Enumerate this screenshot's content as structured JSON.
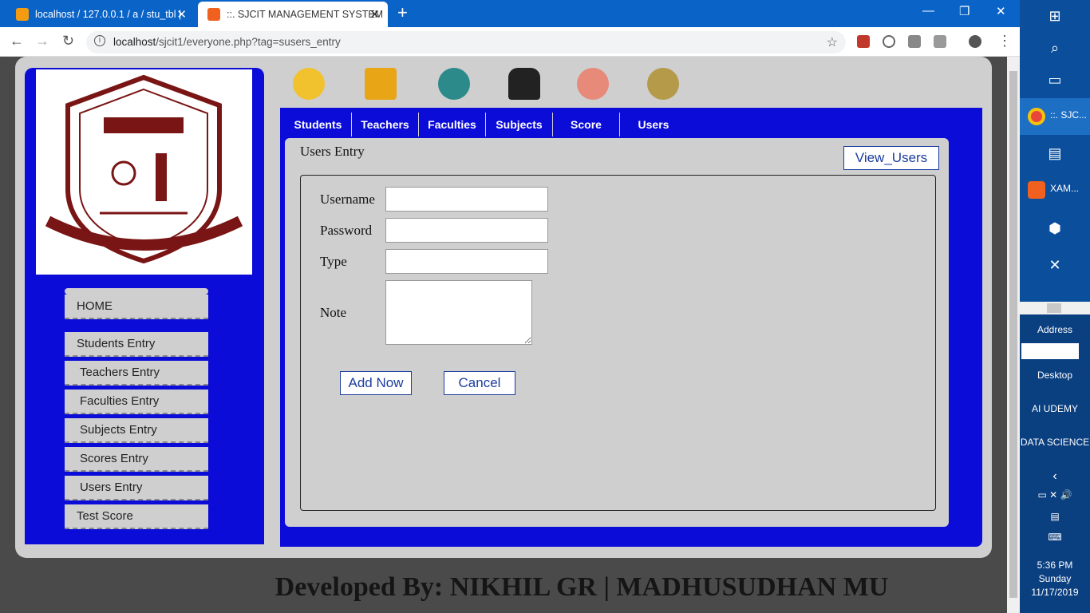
{
  "browser": {
    "tabs": [
      {
        "title": "localhost / 127.0.0.1 / a / stu_tbl |",
        "active": false
      },
      {
        "title": "::. SJCIT MANAGEMENT SYSTEM",
        "active": true
      }
    ],
    "url_host": "localhost",
    "url_path": "/sjcit1/everyone.php?tag=susers_entry"
  },
  "sidebar": {
    "menu": [
      {
        "label": "HOME"
      },
      {
        "label": "Students Entry"
      },
      {
        "label": "Teachers Entry"
      },
      {
        "label": "Faculties Entry"
      },
      {
        "label": "Subjects Entry"
      },
      {
        "label": "Scores Entry"
      },
      {
        "label": "Users Entry"
      },
      {
        "label": "Test Score"
      }
    ]
  },
  "topnav": {
    "tabs": [
      {
        "label": "Students"
      },
      {
        "label": "Teachers"
      },
      {
        "label": "Faculties"
      },
      {
        "label": "Subjects"
      },
      {
        "label": "Score"
      },
      {
        "label": "Users"
      }
    ],
    "icons": [
      "students-icon",
      "teachers-icon",
      "faculties-icon",
      "subjects-icon",
      "score-icon",
      "users-icon"
    ]
  },
  "form": {
    "title": "Users Entry",
    "view_button": "View_Users",
    "username_label": "Username",
    "password_label": "Password",
    "type_label": "Type",
    "note_label": "Note",
    "username_value": "",
    "password_value": "",
    "type_value": "",
    "note_value": "",
    "add_button": "Add Now",
    "cancel_button": "Cancel"
  },
  "footer": {
    "text": "Developed By: NIKHIL GR | MADHUSUDHAN MU"
  },
  "taskbar": {
    "apps": [
      {
        "label": "::. SJC..."
      },
      {
        "label": "XAM..."
      }
    ],
    "address_label": "Address",
    "folders": [
      "Desktop",
      "AI UDEMY",
      "DATA SCIENCE"
    ],
    "time": "5:36 PM",
    "day": "Sunday",
    "date": "11/17/2019"
  }
}
